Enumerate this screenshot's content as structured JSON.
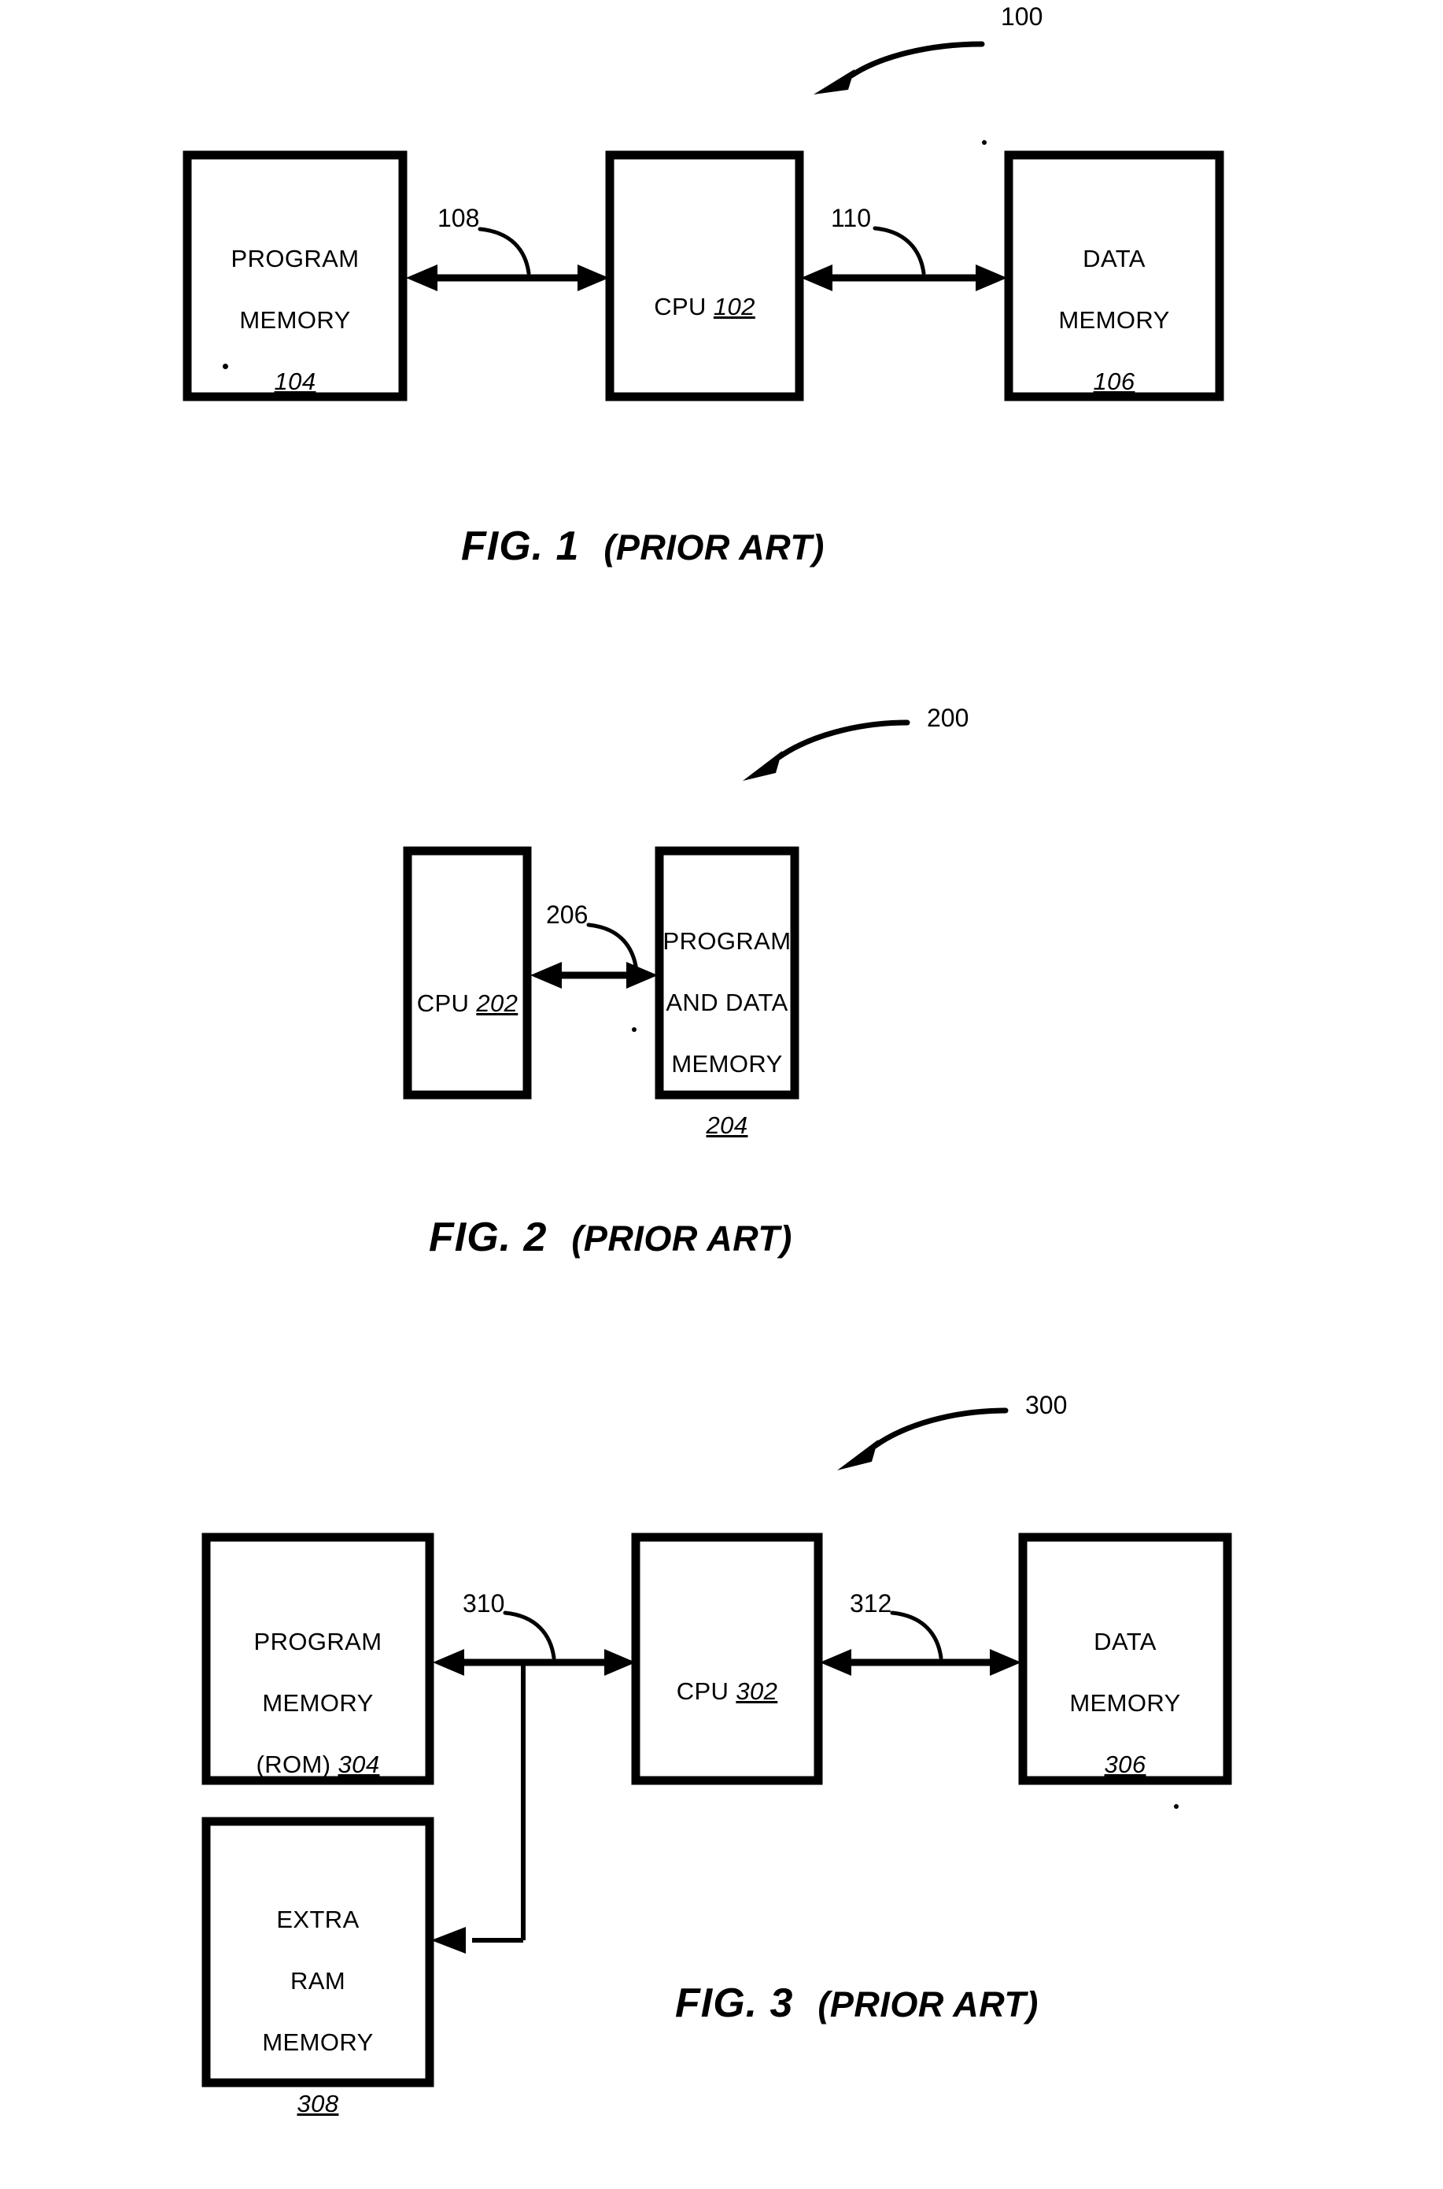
{
  "document": {
    "type": "patent-drawing-sheet",
    "figure_count": 3
  },
  "figures": [
    {
      "id": "fig1",
      "caption_main": "FIG. 1",
      "caption_suffix": "(PRIOR ART)",
      "system_ref": "100",
      "blocks": [
        {
          "id": "program-memory-104",
          "lines": [
            "PROGRAM",
            "MEMORY"
          ],
          "ref": "104",
          "ref_inline": false
        },
        {
          "id": "cpu-102",
          "lines": [
            "CPU"
          ],
          "ref": "102",
          "ref_inline": true
        },
        {
          "id": "data-memory-106",
          "lines": [
            "DATA",
            "MEMORY"
          ],
          "ref": "106",
          "ref_inline": false
        }
      ],
      "connections": [
        {
          "id": "bus-108",
          "ref": "108",
          "from": "program-memory-104",
          "to": "cpu-102",
          "style": "double-arrow"
        },
        {
          "id": "bus-110",
          "ref": "110",
          "from": "cpu-102",
          "to": "data-memory-106",
          "style": "double-arrow"
        }
      ]
    },
    {
      "id": "fig2",
      "caption_main": "FIG. 2",
      "caption_suffix": "(PRIOR ART)",
      "system_ref": "200",
      "blocks": [
        {
          "id": "cpu-202",
          "lines": [
            "CPU"
          ],
          "ref": "202",
          "ref_inline": true
        },
        {
          "id": "program-and-data-memory-204",
          "lines": [
            "PROGRAM",
            "AND DATA",
            "MEMORY"
          ],
          "ref": "204",
          "ref_inline": false
        }
      ],
      "connections": [
        {
          "id": "bus-206",
          "ref": "206",
          "from": "cpu-202",
          "to": "program-and-data-memory-204",
          "style": "double-arrow"
        }
      ]
    },
    {
      "id": "fig3",
      "caption_main": "FIG. 3",
      "caption_suffix": "(PRIOR ART)",
      "system_ref": "300",
      "blocks": [
        {
          "id": "program-memory-rom-304",
          "lines": [
            "PROGRAM",
            "MEMORY",
            "(ROM)"
          ],
          "ref": "304",
          "ref_inline": true
        },
        {
          "id": "extra-ram-memory-308",
          "lines": [
            "EXTRA",
            "RAM",
            "MEMORY"
          ],
          "ref": "308",
          "ref_inline": false
        },
        {
          "id": "cpu-302",
          "lines": [
            "CPU"
          ],
          "ref": "302",
          "ref_inline": true
        },
        {
          "id": "data-memory-306",
          "lines": [
            "DATA",
            "MEMORY"
          ],
          "ref": "306",
          "ref_inline": false
        }
      ],
      "connections": [
        {
          "id": "bus-310",
          "ref": "310",
          "from": "program-memory-rom-304",
          "to": "cpu-302",
          "style": "double-arrow"
        },
        {
          "id": "bus-312",
          "ref": "312",
          "from": "cpu-302",
          "to": "data-memory-306",
          "style": "double-arrow"
        },
        {
          "id": "branch-to-extra-ram",
          "ref": "",
          "from": "bus-310",
          "to": "extra-ram-memory-308",
          "style": "single-arrow"
        }
      ]
    }
  ],
  "labels": {
    "fig1_block1_line1": "PROGRAM",
    "fig1_block1_line2": "MEMORY",
    "fig1_block1_ref": "104",
    "fig1_block2_text": "CPU",
    "fig1_block2_ref": "102",
    "fig1_block3_line1": "DATA",
    "fig1_block3_line2": "MEMORY",
    "fig1_block3_ref": "106",
    "fig1_lead_108": "108",
    "fig1_lead_110": "110",
    "fig1_lead_100": "100",
    "fig1_caption": "FIG. 1",
    "fig1_caption_suffix": "(PRIOR ART)",
    "fig2_block1_text": "CPU",
    "fig2_block1_ref": "202",
    "fig2_block2_line1": "PROGRAM",
    "fig2_block2_line2": "AND DATA",
    "fig2_block2_line3": "MEMORY",
    "fig2_block2_ref": "204",
    "fig2_lead_206": "206",
    "fig2_lead_200": "200",
    "fig2_caption": "FIG. 2",
    "fig2_caption_suffix": "(PRIOR ART)",
    "fig3_block1_line1": "PROGRAM",
    "fig3_block1_line2": "MEMORY",
    "fig3_block1_line3": "(ROM)",
    "fig3_block1_ref": "304",
    "fig3_block2_line1": "EXTRA",
    "fig3_block2_line2": "RAM",
    "fig3_block2_line3": "MEMORY",
    "fig3_block2_ref": "308",
    "fig3_block3_text": "CPU",
    "fig3_block3_ref": "302",
    "fig3_block4_line1": "DATA",
    "fig3_block4_line2": "MEMORY",
    "fig3_block4_ref": "306",
    "fig3_lead_310": "310",
    "fig3_lead_312": "312",
    "fig3_lead_300": "300",
    "fig3_caption": "FIG. 3",
    "fig3_caption_suffix": "(PRIOR ART)"
  },
  "colors": {
    "ink": "#000000",
    "paper": "#ffffff"
  }
}
